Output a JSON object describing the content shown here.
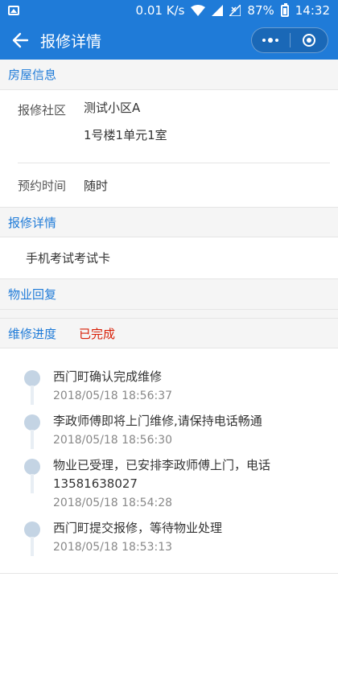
{
  "status_bar": {
    "speed": "0.01 K/s",
    "battery": "87%",
    "time": "14:32"
  },
  "nav": {
    "title": "报修详情"
  },
  "house": {
    "section_title": "房屋信息",
    "community_label": "报修社区",
    "community_value": "测试小区A",
    "address_value": "1号楼1单元1室",
    "appointment_label": "预约时间",
    "appointment_value": "随时"
  },
  "repair": {
    "section_title": "报修详情",
    "content": "手机考试考试卡"
  },
  "reply": {
    "section_title": "物业回复"
  },
  "progress": {
    "section_title": "维修进度",
    "status": "已完成",
    "status_color": "#d81e06",
    "items": [
      {
        "text": "西门町确认完成维修",
        "time": "2018/05/18 18:56:37"
      },
      {
        "text": "李政师傅即将上门维修,请保持电话畅通",
        "time": "2018/05/18 18:56:30"
      },
      {
        "text": "物业已受理，已安排李政师傅上门，电话13581638027",
        "time": "2018/05/18 18:54:28"
      },
      {
        "text": "西门町提交报修，等待物业处理",
        "time": "2018/05/18 18:53:13"
      }
    ]
  },
  "colors": {
    "primary": "#1f7bd8",
    "accent_red": "#d81e06"
  }
}
